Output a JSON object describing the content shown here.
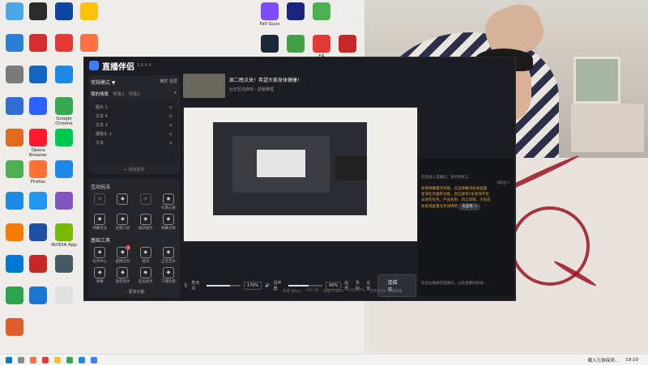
{
  "desktop": {
    "icons_left": [
      {
        "label": "",
        "color": "#4aa8e8"
      },
      {
        "label": "",
        "color": "#2b7fd6"
      },
      {
        "label": "",
        "color": "#7b7b7b"
      },
      {
        "label": "",
        "color": "#2f6fd1"
      },
      {
        "label": "",
        "color": "#e06b1c"
      },
      {
        "label": "",
        "color": "#4caf50"
      },
      {
        "label": "",
        "color": "#1e88e5"
      },
      {
        "label": "",
        "color": "#f57c00"
      },
      {
        "label": "",
        "color": "#0078d4"
      },
      {
        "label": "",
        "color": "#2da44e"
      },
      {
        "label": "",
        "color": "#e05e2c"
      }
    ],
    "icons_mid": [
      {
        "label": "",
        "color": "#2b2b2b"
      },
      {
        "label": "",
        "color": "#d32f2f"
      },
      {
        "label": "",
        "color": "#1565c0"
      },
      {
        "label": "",
        "color": "#2962ff"
      },
      {
        "label": "Opera Browser",
        "color": "#ff1b2d"
      },
      {
        "label": "Firefox",
        "color": "#ff7139"
      },
      {
        "label": "",
        "color": "#2196f3"
      },
      {
        "label": "",
        "color": "#1e4fa3"
      },
      {
        "label": "",
        "color": "#c62828"
      },
      {
        "label": "",
        "color": "#1976d2"
      }
    ],
    "icons_col3": [
      {
        "label": "",
        "color": "#0d47a1"
      },
      {
        "label": "",
        "color": "#e53935"
      },
      {
        "label": "",
        "color": "#1e88e5"
      },
      {
        "label": "Google Chrome",
        "color": "#34a853"
      },
      {
        "label": "",
        "color": "#00c853"
      },
      {
        "label": "",
        "color": "#1e88e5"
      },
      {
        "label": "",
        "color": "#7e57c2"
      },
      {
        "label": "NVIDIA App",
        "color": "#76b900"
      },
      {
        "label": "",
        "color": "#455a64"
      },
      {
        "label": "",
        "color": "#e0e0e0"
      }
    ],
    "icons_col4": [
      {
        "label": "",
        "color": "#ffc107"
      },
      {
        "label": "",
        "color": "#ff7043"
      }
    ],
    "icons_top_right": [
      {
        "label": "Fall Guys",
        "color": "#7c4dff"
      },
      {
        "label": "",
        "color": "#1a237e"
      },
      {
        "label": "",
        "color": "#4caf50"
      },
      {
        "label": "",
        "color": "#eeeeee"
      },
      {
        "label": "",
        "color": "#1b2838"
      },
      {
        "label": "",
        "color": "#43a047"
      },
      {
        "label": "EA",
        "color": "#e53935"
      },
      {
        "label": "",
        "color": "#c62828"
      }
    ]
  },
  "app": {
    "name": "直播伴侣",
    "version": "3.5.5.4",
    "mode": "常规模式 ▼",
    "mode_tags": [
      "横屏",
      "竖屏"
    ],
    "scene_tabs": [
      "我的场景",
      "场景2",
      "场景3"
    ],
    "sources": [
      {
        "name": "图片 1"
      },
      {
        "name": "文本 4"
      },
      {
        "name": "文本 3"
      },
      {
        "name": "摄像头 1"
      },
      {
        "name": "文本"
      }
    ],
    "add_source": "+ 添加素材",
    "section_interact": "互动玩法",
    "interact_tools": [
      {
        "label": "",
        "dim": true
      },
      {
        "label": "",
        "dim": false
      },
      {
        "label": "",
        "dim": true
      },
      {
        "label": "礼物心愿",
        "dim": false
      },
      {
        "label": "弹幕玩法",
        "dim": false
      },
      {
        "label": "主播口袋",
        "dim": false
      },
      {
        "label": "福袋抽奖",
        "dim": false
      },
      {
        "label": "弹幕点歌",
        "dim": false
      }
    ],
    "section_basic": "基础工具",
    "basic_tools": [
      {
        "label": "任务中心",
        "badge": ""
      },
      {
        "label": "直播任务",
        "badge": "1"
      },
      {
        "label": "道具",
        "badge": ""
      },
      {
        "label": "正音音乐",
        "badge": ""
      },
      {
        "label": "弹幕",
        "badge": ""
      },
      {
        "label": "放音助手",
        "badge": ""
      },
      {
        "label": "电竞助手",
        "badge": ""
      },
      {
        "label": "下播场景",
        "badge": ""
      }
    ],
    "more": "更多功能",
    "live_title": "周二晚点来！希望大家身体健康！",
    "live_tags": [
      "社交互动游戏 · 逻辑推理"
    ],
    "mic_label": "麦克风",
    "mic_value": "170%",
    "speaker_label": "扬声器",
    "speaker_value": "90%",
    "mic_level": 0.7,
    "speaker_level": 0.6,
    "ctrl_icons": [
      "画质",
      "录制",
      "设置"
    ],
    "start_button": "连接中...",
    "status": [
      "码率 0Kb/s",
      "FPS 30",
      "丢帧 0.00%",
      "CPU 27%",
      "内存 85%",
      "未开播"
    ],
    "chat_lines": [
      "欢迎进入直播间，请文明发言…",
      "0粉丝人",
      "新增弹幕置顶功能，点击弹幕添加进画面",
      "星海任务推荐功能，您已收到1条星海平台",
      "派发的任务。产品名称：风之领域，点击前",
      "往星海查看任务详情吧"
    ],
    "chat_button": "去查看 >",
    "chat_footer": "欢迎主播来到直播间，以及直播间新规…"
  },
  "taskbar": {
    "notice": "载入万球探测…",
    "clock": "19:29"
  }
}
